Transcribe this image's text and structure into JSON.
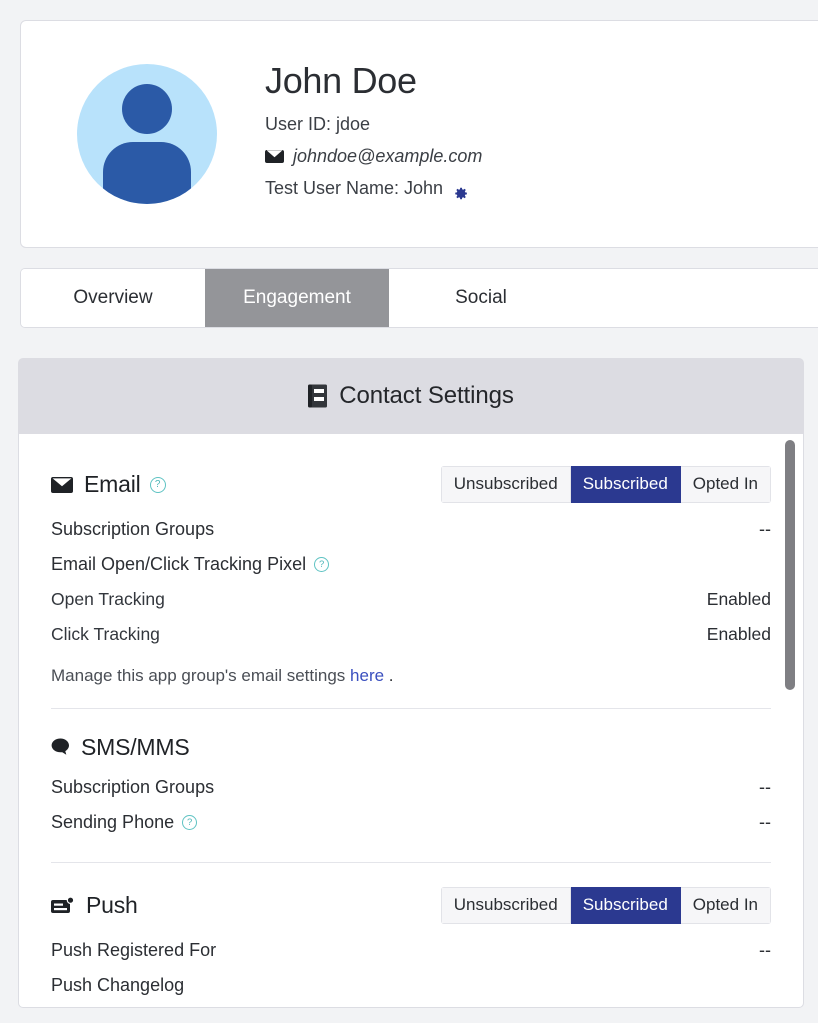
{
  "profile": {
    "name": "John Doe",
    "user_id_line": "User ID: jdoe",
    "email": "johndoe@example.com",
    "test_user_name_line": "Test User Name: John",
    "avatar_bg_color": "#b8e2fb",
    "avatar_fg_color": "#2b5aa7",
    "gear_color": "#2b3990"
  },
  "tabs": [
    {
      "label": "Overview",
      "active": false
    },
    {
      "label": "Engagement",
      "active": true
    },
    {
      "label": "Social",
      "active": false
    }
  ],
  "settings_panel": {
    "header_title": "Contact Settings",
    "header_icon": "address-book-icon",
    "header_bg_color": "#dcdce2",
    "active_segment_color": "#2b3990",
    "help_icon_color": "#4fb6b8",
    "link_color": "#3b50bf",
    "channels": [
      {
        "id": "email",
        "title": "Email",
        "icon": "envelope-icon",
        "has_help": true,
        "segments": [
          {
            "label": "Unsubscribed",
            "active": false
          },
          {
            "label": "Subscribed",
            "active": true
          },
          {
            "label": "Opted In",
            "active": false
          }
        ],
        "rows": [
          {
            "label": "Subscription Groups",
            "value": "--",
            "help": false
          },
          {
            "label": "Email Open/Click Tracking Pixel",
            "value": "",
            "help": true
          },
          {
            "label": "Open Tracking",
            "value": "Enabled",
            "help": false,
            "sub": true
          },
          {
            "label": "Click Tracking",
            "value": "Enabled",
            "help": false,
            "sub": true
          }
        ],
        "note": {
          "prefix": "Manage this app group's email settings ",
          "link": "here",
          "suffix": " ."
        }
      },
      {
        "id": "sms",
        "title": "SMS/MMS",
        "icon": "chat-bubble-icon",
        "has_help": false,
        "segments": [],
        "rows": [
          {
            "label": "Subscription Groups",
            "value": "--",
            "help": false
          },
          {
            "label": "Sending Phone",
            "value": "--",
            "help": true
          }
        ],
        "note": null
      },
      {
        "id": "push",
        "title": "Push",
        "icon": "push-notification-icon",
        "has_help": false,
        "segments": [
          {
            "label": "Unsubscribed",
            "active": false
          },
          {
            "label": "Subscribed",
            "active": true
          },
          {
            "label": "Opted In",
            "active": false
          }
        ],
        "rows": [
          {
            "label": "Push Registered For",
            "value": "--",
            "help": false
          },
          {
            "label": "Push Changelog",
            "value": "",
            "help": false
          }
        ],
        "note": null
      }
    ]
  }
}
